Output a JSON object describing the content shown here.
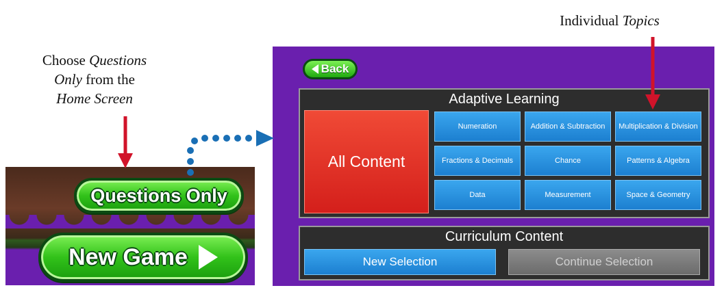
{
  "captions": {
    "left": {
      "line1_plain": "Choose ",
      "line1_italic": "Questions",
      "line2_italic": "Only",
      "line2_plain": " from the",
      "line3_italic": "Home Screen"
    },
    "right": {
      "plain": "Individual ",
      "italic": "Topics"
    }
  },
  "home_screen": {
    "questions_only_label": "Questions Only",
    "new_game_label": "New Game"
  },
  "app": {
    "back_label": "Back",
    "adaptive_title": "Adaptive Learning",
    "all_content_label": "All Content",
    "topics": [
      "Numeration",
      "Addition & Subtraction",
      "Multiplication & Division",
      "Fractions & Decimals",
      "Chance",
      "Patterns & Algebra",
      "Data",
      "Measurement",
      "Space & Geometry"
    ],
    "curriculum_title": "Curriculum Content",
    "new_selection_label": "New Selection",
    "continue_selection_label": "Continue Selection"
  },
  "colors": {
    "arrow_red": "#d1132a",
    "dotted_blue": "#1a6fb5",
    "screen_purple": "#6a1fae",
    "tile_blue": "#1c7fd0",
    "tile_red": "#d41f1b",
    "button_green": "#32c21a"
  }
}
